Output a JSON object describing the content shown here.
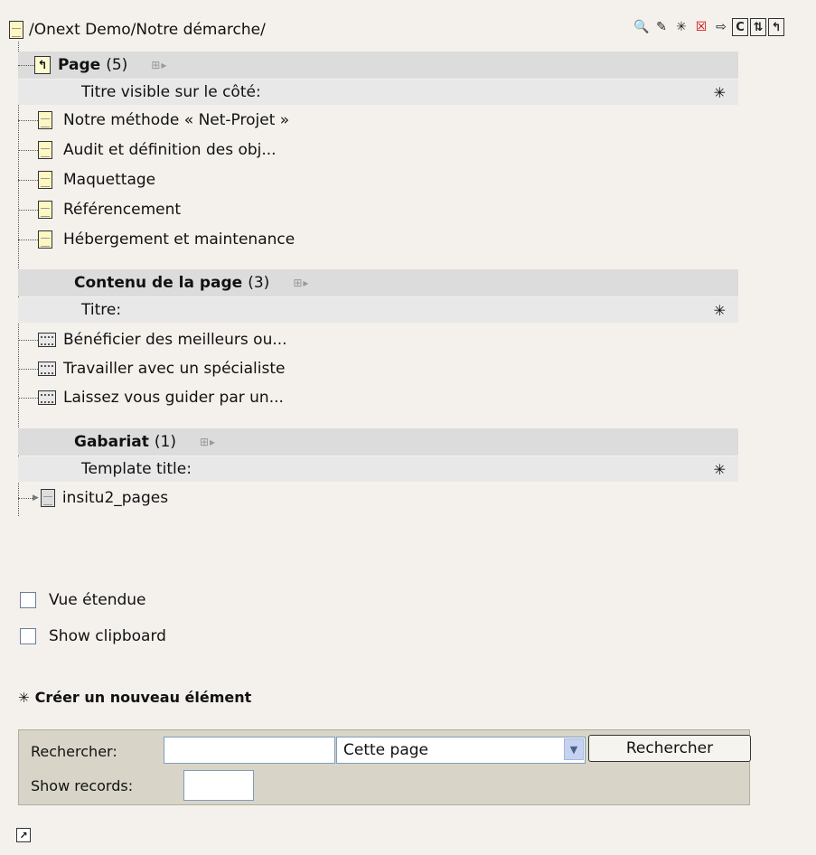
{
  "path": "/Onext Demo/Notre démarche/",
  "toolbar_icons": [
    "search-icon",
    "edit-icon",
    "new-icon",
    "delete-icon",
    "export-icon",
    "clear-cache-icon",
    "refresh-icon",
    "up-level-icon"
  ],
  "toolbar_labels": {
    "clear": "C"
  },
  "sections": [
    {
      "title": "Page",
      "count": "(5)",
      "sublabel": "Titre visible sur le côté:",
      "items": [
        "Notre méthode « Net-Projet »",
        "Audit et définition des obj...",
        "Maquettage",
        "Référencement",
        "Hébergement et maintenance"
      ]
    },
    {
      "title": "Contenu de la page",
      "count": "(3)",
      "sublabel": "Titre:",
      "items": [
        "Bénéficier des meilleurs ou...",
        "Travailler avec un spécialiste",
        "Laissez vous guider par un..."
      ]
    },
    {
      "title": "Gabariat",
      "count": "(1)",
      "sublabel": "Template title:",
      "items": [
        "insitu2_pages"
      ]
    }
  ],
  "options": {
    "extended_view": "Vue étendue",
    "show_clipboard": "Show clipboard"
  },
  "create_new": "Créer un nouveau élément",
  "search": {
    "label": "Rechercher:",
    "value": "",
    "scope_selected": "Cette page",
    "button": "Rechercher",
    "records_label": "Show records:",
    "records_value": ""
  }
}
